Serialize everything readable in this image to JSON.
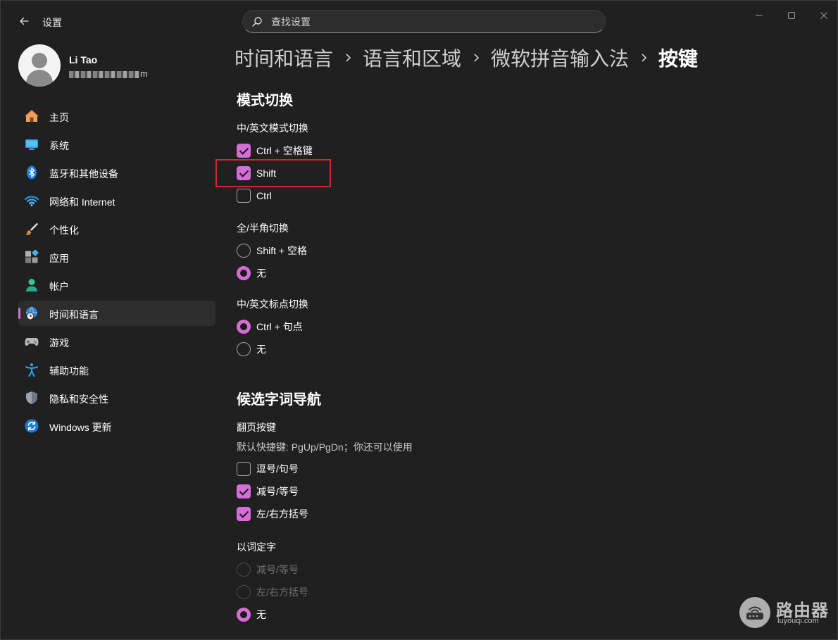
{
  "window": {
    "app_title": "设置",
    "search": {
      "placeholder": "查找设置",
      "value": ""
    }
  },
  "profile": {
    "name": "Li Tao",
    "email_suffix": "m"
  },
  "sidebar": {
    "items": [
      {
        "label": "主页",
        "icon": "home-icon"
      },
      {
        "label": "系统",
        "icon": "monitor-icon"
      },
      {
        "label": "蓝牙和其他设备",
        "icon": "bluetooth-icon"
      },
      {
        "label": "网络和 Internet",
        "icon": "wifi-icon"
      },
      {
        "label": "个性化",
        "icon": "brush-icon"
      },
      {
        "label": "应用",
        "icon": "apps-icon"
      },
      {
        "label": "帐户",
        "icon": "person-icon"
      },
      {
        "label": "时间和语言",
        "icon": "globe-clock-icon",
        "active": true
      },
      {
        "label": "游戏",
        "icon": "gamepad-icon"
      },
      {
        "label": "辅助功能",
        "icon": "accessibility-icon"
      },
      {
        "label": "隐私和安全性",
        "icon": "shield-icon"
      },
      {
        "label": "Windows 更新",
        "icon": "refresh-icon"
      }
    ]
  },
  "breadcrumb": [
    "时间和语言",
    "语言和区域",
    "微软拼音输入法",
    "按键"
  ],
  "sections": {
    "mode_switch": {
      "title": "模式切换",
      "cn_en_mode": {
        "label": "中/英文模式切换",
        "options": [
          {
            "label": "Ctrl + 空格键",
            "checked": true
          },
          {
            "label": "Shift",
            "checked": true
          },
          {
            "label": "Ctrl",
            "checked": false
          }
        ]
      },
      "full_half": {
        "label": "全/半角切换",
        "options": [
          {
            "label": "Shift + 空格",
            "selected": false
          },
          {
            "label": "无",
            "selected": true
          }
        ]
      },
      "punct": {
        "label": "中/英文标点切换",
        "options": [
          {
            "label": "Ctrl + 句点",
            "selected": true
          },
          {
            "label": "无",
            "selected": false
          }
        ]
      }
    },
    "candidate_nav": {
      "title": "候选字词导航",
      "paging": {
        "label": "翻页按键",
        "hint": "默认快捷键: PgUp/PgDn；你还可以使用",
        "options": [
          {
            "label": "逗号/句号",
            "checked": false
          },
          {
            "label": "减号/等号",
            "checked": true
          },
          {
            "label": "左/右方括号",
            "checked": true
          }
        ]
      },
      "word_pick": {
        "label": "以词定字",
        "options": [
          {
            "label": "减号/等号",
            "selected": false,
            "disabled": true
          },
          {
            "label": "左/右方括号",
            "selected": false,
            "disabled": true
          },
          {
            "label": "无",
            "selected": true,
            "disabled": false
          }
        ]
      }
    }
  },
  "watermark": {
    "title": "路由器",
    "subtitle": "luyouqi.com"
  },
  "colors": {
    "accent": "#d56cd7",
    "background": "#202020",
    "highlight_border": "#d4272b"
  }
}
